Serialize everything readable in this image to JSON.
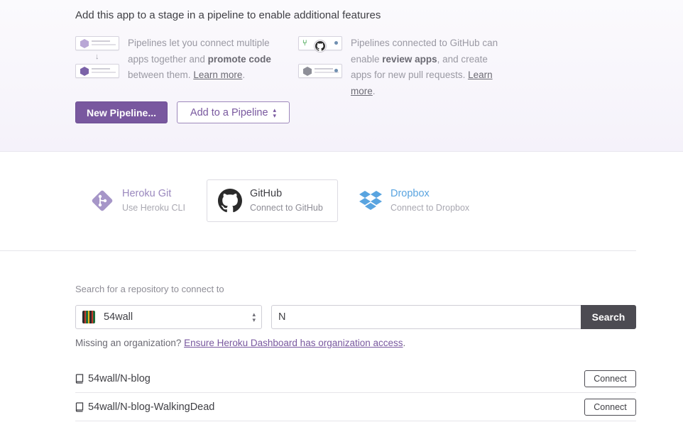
{
  "pipeline": {
    "heading": "Add this app to a stage in a pipeline to enable additional features",
    "feature1": {
      "pre": "Pipelines let you connect multiple apps together and ",
      "bold": "promote code",
      "post": " between them. ",
      "link": "Learn more",
      "end": "."
    },
    "feature2": {
      "pre": "Pipelines connected to GitHub can enable ",
      "bold": "review apps",
      "post": ", and create apps for new pull requests. ",
      "link": "Learn more",
      "end": "."
    },
    "new_button": "New Pipeline...",
    "add_button": "Add to a Pipeline"
  },
  "deploy_methods": {
    "heroku": {
      "title": "Heroku Git",
      "subtitle": "Use Heroku CLI"
    },
    "github": {
      "title": "GitHub",
      "subtitle": "Connect to GitHub"
    },
    "dropbox": {
      "title": "Dropbox",
      "subtitle": "Connect to Dropbox"
    }
  },
  "repo_search": {
    "label": "Search for a repository to connect to",
    "org": "54wall",
    "query": "N",
    "search_button": "Search",
    "missing_text": "Missing an organization? ",
    "missing_link": "Ensure Heroku Dashboard has organization access",
    "missing_end": "."
  },
  "repos": [
    {
      "name": "54wall/N-blog",
      "button": "Connect"
    },
    {
      "name": "54wall/N-blog-WalkingDead",
      "button": "Connect"
    }
  ],
  "colors": {
    "primary": "#79589f",
    "github_text": "#3f3f44",
    "dropbox_blue": "#59a4e0",
    "heroku_purple": "#9a88be",
    "search_button_bg": "#4c4b52"
  },
  "icons": {
    "heroku": "git-branch-icon",
    "github": "github-octocat-icon",
    "dropbox": "dropbox-icon",
    "repo": "book-icon"
  }
}
